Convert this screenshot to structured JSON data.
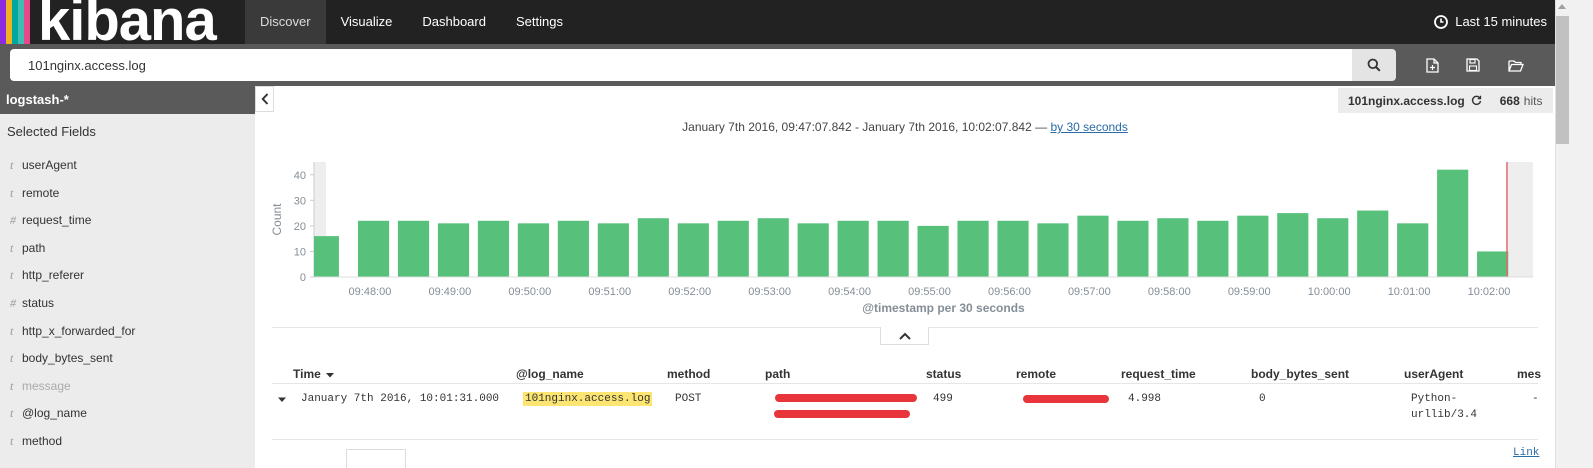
{
  "app": {
    "logo_text": "kibana",
    "logo_colors": [
      "#e8478b",
      "#f0b31d",
      "#00a7a1",
      "#3ebeb0",
      "#8a2be2"
    ]
  },
  "nav": {
    "tabs": [
      {
        "label": "Discover",
        "active": true
      },
      {
        "label": "Visualize",
        "active": false
      },
      {
        "label": "Dashboard",
        "active": false
      },
      {
        "label": "Settings",
        "active": false
      }
    ],
    "time_label": "Last 15 minutes"
  },
  "search": {
    "query": "101nginx.access.log",
    "icon": "search-icon",
    "tools": [
      "new-document-icon",
      "save-icon",
      "open-folder-icon"
    ]
  },
  "sidebar": {
    "index_pattern": "logstash-*",
    "selected_title": "Selected Fields",
    "fields": [
      {
        "type": "t",
        "name": "userAgent",
        "muted": false
      },
      {
        "type": "t",
        "name": "remote",
        "muted": false
      },
      {
        "type": "#",
        "name": "request_time",
        "muted": false
      },
      {
        "type": "t",
        "name": "path",
        "muted": false
      },
      {
        "type": "t",
        "name": "http_referer",
        "muted": false
      },
      {
        "type": "#",
        "name": "status",
        "muted": false
      },
      {
        "type": "t",
        "name": "http_x_forwarded_for",
        "muted": false
      },
      {
        "type": "t",
        "name": "body_bytes_sent",
        "muted": false
      },
      {
        "type": "t",
        "name": "message",
        "muted": true
      },
      {
        "type": "t",
        "name": "@log_name",
        "muted": false
      },
      {
        "type": "t",
        "name": "method",
        "muted": false
      }
    ]
  },
  "hits": {
    "index": "101nginx.access.log",
    "count": "668",
    "label": "hits"
  },
  "timerange": {
    "text": "January 7th 2016, 09:47:07.842 - January 7th 2016, 10:02:07.842 —",
    "interval": "by 30 seconds"
  },
  "chart_data": {
    "type": "bar",
    "color": "#57c17b",
    "ylabel": "Count",
    "xlabel": "@timestamp per 30 seconds",
    "ylim": [
      0,
      45
    ],
    "yticks": [
      0,
      10,
      20,
      30,
      40
    ],
    "xticks": [
      "09:48:00",
      "09:49:00",
      "09:50:00",
      "09:51:00",
      "09:52:00",
      "09:53:00",
      "09:54:00",
      "09:55:00",
      "09:56:00",
      "09:57:00",
      "09:58:00",
      "09:59:00",
      "10:00:00",
      "10:01:00",
      "10:02:00"
    ],
    "values": [
      16,
      22,
      22,
      21,
      22,
      21,
      22,
      21,
      23,
      21,
      22,
      23,
      21,
      22,
      22,
      20,
      22,
      22,
      21,
      24,
      22,
      23,
      22,
      24,
      25,
      23,
      26,
      21,
      42,
      10
    ]
  },
  "table": {
    "columns": [
      "Time",
      "@log_name",
      "method",
      "path",
      "status",
      "remote",
      "request_time",
      "body_bytes_sent",
      "userAgent",
      "mes"
    ],
    "sort_icon": "caret-down-icon",
    "row": {
      "time": "January 7th 2016, 10:01:31.000",
      "log_name": "101nginx.access.log",
      "method": "POST",
      "status": "499",
      "request_time": "4.998",
      "body_bytes_sent": "0",
      "user_agent_1": "Python-",
      "user_agent_2": "urllib/3.4",
      "mes": "-"
    },
    "link": "Link"
  }
}
